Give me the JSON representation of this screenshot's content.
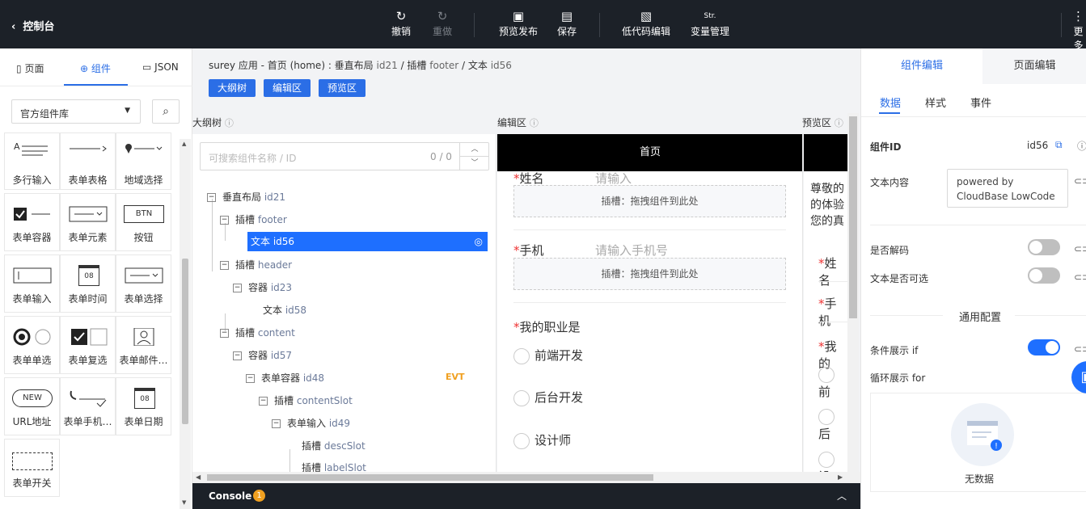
{
  "topbar": {
    "back_label": "控制台",
    "actions": [
      {
        "label": "撤销",
        "icon": "undo-icon",
        "glyph": "↻",
        "disabled": false
      },
      {
        "label": "重做",
        "icon": "redo-icon",
        "glyph": "↻",
        "disabled": true
      },
      {
        "label": "预览发布",
        "icon": "preview-publish-icon",
        "glyph": "▣",
        "disabled": false
      },
      {
        "label": "保存",
        "icon": "save-icon",
        "glyph": "▤",
        "disabled": false
      },
      {
        "label": "低代码编辑",
        "icon": "lowcode-edit-icon",
        "glyph": "▧",
        "disabled": false
      },
      {
        "label": "变量管理",
        "icon": "variable-icon",
        "glyph": "Str.",
        "disabled": false
      }
    ],
    "more_label": "更多"
  },
  "left": {
    "tabs": [
      {
        "label": "页面",
        "glyph": "▯"
      },
      {
        "label": "组件",
        "glyph": "⊕"
      },
      {
        "label": "JSON",
        "glyph": "▭"
      }
    ],
    "library_select": "官方组件库",
    "components": [
      "多行输入",
      "表单表格",
      "地域选择",
      "表单容器",
      "表单元素",
      "按钮",
      "表单输入",
      "表单时间",
      "表单选择",
      "表单单选",
      "表单复选",
      "表单邮件…",
      "URL地址",
      "表单手机…",
      "表单日期",
      "表单开关"
    ],
    "btn_text": "BTN",
    "new_text": "NEW",
    "date_text": "08"
  },
  "center": {
    "breadcrumb": {
      "app": "surey 应用",
      "page": "首页 (home)",
      "n1": "垂直布局",
      "id1": "id21",
      "n2": "插槽",
      "id2": "footer",
      "n3": "文本",
      "id3": "id56"
    },
    "view_buttons": [
      "大纲树",
      "编辑区",
      "预览区"
    ],
    "panel_titles": [
      "大纲树",
      "编辑区",
      "预览区"
    ],
    "outline": {
      "search_placeholder": "可搜索组件名称 / ID",
      "count": "0 / 0",
      "nodes": [
        {
          "name": "垂直布局",
          "id": "id21"
        },
        {
          "name": "插槽",
          "id": "footer"
        },
        {
          "name": "文本",
          "id": "id56"
        },
        {
          "name": "插槽",
          "id": "header"
        },
        {
          "name": "容器",
          "id": "id23"
        },
        {
          "name": "文本",
          "id": "id58"
        },
        {
          "name": "插槽",
          "id": "content"
        },
        {
          "name": "容器",
          "id": "id57"
        },
        {
          "name": "表单容器",
          "id": "id48"
        },
        {
          "name": "插槽",
          "id": "contentSlot"
        },
        {
          "name": "表单输入",
          "id": "id49"
        },
        {
          "name": "插槽",
          "id": "descSlot"
        },
        {
          "name": "插槽",
          "id": "labelSlot"
        }
      ],
      "evt_badge": "EVT"
    },
    "editor": {
      "header": "首页",
      "name_label": "姓名",
      "name_placeholder": "请输入",
      "slot_text": "插槽：拖拽组件到此处",
      "phone_label": "手机",
      "phone_placeholder": "请输入手机号",
      "job_label": "我的职业是",
      "options": [
        "前端开发",
        "后台开发",
        "设计师"
      ]
    },
    "preview": {
      "lines": [
        "尊敬的",
        "的体验",
        "您的真"
      ],
      "name_label": "姓名",
      "phone_label": "手机",
      "job_label": "我的",
      "options": [
        "前",
        "后",
        "设"
      ]
    },
    "console": {
      "label": "Console",
      "count": "1"
    }
  },
  "right": {
    "tabs": [
      "组件编辑",
      "页面编辑"
    ],
    "subtabs": [
      "数据",
      "样式",
      "事件"
    ],
    "component_id_label": "组件ID",
    "component_id_value": "id56",
    "text_content_label": "文本内容",
    "text_content_value": "powered by CloudBase LowCode",
    "decode_label": "是否解码",
    "selectable_label": "文本是否可选",
    "general_config": "通用配置",
    "condition_label": "条件展示 if",
    "loop_label": "循环展示 for",
    "empty_text": "无数据",
    "toggles": {
      "decode": false,
      "selectable": false,
      "condition": true
    }
  }
}
